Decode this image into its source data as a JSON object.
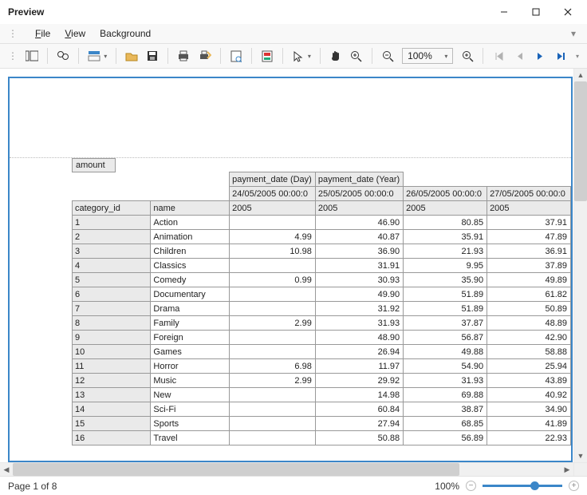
{
  "window": {
    "title": "Preview"
  },
  "menu": {
    "file": "File",
    "view": "View",
    "background": "Background"
  },
  "toolbar": {
    "zoom_label": "100%"
  },
  "status": {
    "page_text": "Page 1 of 8",
    "zoom_text": "100%"
  },
  "report": {
    "amount_label": "amount",
    "col_day": "payment_date (Day)",
    "col_year": "payment_date (Year)",
    "dates": [
      "24/05/2005 00:00:0",
      "25/05/2005 00:00:0",
      "26/05/2005 00:00:0",
      "27/05/2005 00:00:0"
    ],
    "year_row": "2005",
    "row_headers": [
      "category_id",
      "name"
    ],
    "rows": [
      {
        "id": "1",
        "name": "Action",
        "vals": [
          "",
          "46.90",
          "80.85",
          "37.91"
        ]
      },
      {
        "id": "2",
        "name": "Animation",
        "vals": [
          "4.99",
          "40.87",
          "35.91",
          "47.89"
        ]
      },
      {
        "id": "3",
        "name": "Children",
        "vals": [
          "10.98",
          "36.90",
          "21.93",
          "36.91"
        ]
      },
      {
        "id": "4",
        "name": "Classics",
        "vals": [
          "",
          "31.91",
          "9.95",
          "37.89"
        ]
      },
      {
        "id": "5",
        "name": "Comedy",
        "vals": [
          "0.99",
          "30.93",
          "35.90",
          "49.89"
        ]
      },
      {
        "id": "6",
        "name": "Documentary",
        "vals": [
          "",
          "49.90",
          "51.89",
          "61.82"
        ]
      },
      {
        "id": "7",
        "name": "Drama",
        "vals": [
          "",
          "31.92",
          "51.89",
          "50.89"
        ]
      },
      {
        "id": "8",
        "name": "Family",
        "vals": [
          "2.99",
          "31.93",
          "37.87",
          "48.89"
        ]
      },
      {
        "id": "9",
        "name": "Foreign",
        "vals": [
          "",
          "48.90",
          "56.87",
          "42.90"
        ]
      },
      {
        "id": "10",
        "name": "Games",
        "vals": [
          "",
          "26.94",
          "49.88",
          "58.88"
        ]
      },
      {
        "id": "11",
        "name": "Horror",
        "vals": [
          "6.98",
          "11.97",
          "54.90",
          "25.94"
        ]
      },
      {
        "id": "12",
        "name": "Music",
        "vals": [
          "2.99",
          "29.92",
          "31.93",
          "43.89"
        ]
      },
      {
        "id": "13",
        "name": "New",
        "vals": [
          "",
          "14.98",
          "69.88",
          "40.92"
        ]
      },
      {
        "id": "14",
        "name": "Sci-Fi",
        "vals": [
          "",
          "60.84",
          "38.87",
          "34.90"
        ]
      },
      {
        "id": "15",
        "name": "Sports",
        "vals": [
          "",
          "27.94",
          "68.85",
          "41.89"
        ]
      },
      {
        "id": "16",
        "name": "Travel",
        "vals": [
          "",
          "50.88",
          "56.89",
          "22.93"
        ]
      }
    ]
  }
}
